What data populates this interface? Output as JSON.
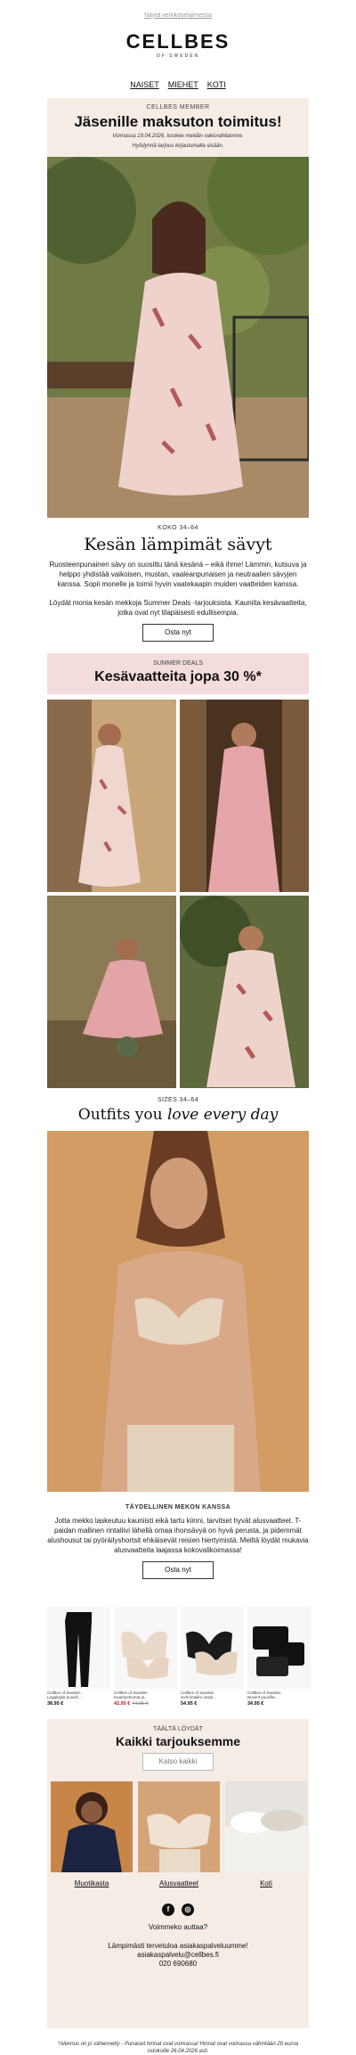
{
  "preheader": {
    "link": "Näytä verkkoselaimessa"
  },
  "logo": {
    "brand": "CELLBES",
    "sub": "OF SWEDEN"
  },
  "nav": [
    "NAISET",
    "MIEHET",
    "KOTI"
  ],
  "member": {
    "kicker": "CELLBES MEMBER",
    "title": "Jäsenille maksuton toimitus!",
    "note1": "Voimassa 19.04.2026, koskee meidän vakiorahtiamme.",
    "note2": "Hyödynnä tarjous kirjautumalla sisään."
  },
  "warm": {
    "kicker": "KOKO 34–64",
    "title": "Kesän lämpimät sävyt",
    "p1": "Ruosteenpunainen sävy on suosittu tänä kesänä – eikä ihme! Lämmin, kutsuva ja helppo yhdistää vaikoisen, mustan, vaaleanpunaisen ja neutraalien sävyjen kanssa. Sopii monelle ja toimii hyvin vaatekaapin muiden vaatteiden kanssa.",
    "p2": "Löydät monia kesän mekkoja Summer Deals -tarjouksista. Kauniita kesävaatteita, jotka ovat nyt tilapäisesti edullisempia.",
    "cta": "Osta nyt"
  },
  "deals": {
    "kicker": "SUMMER DEALS",
    "title": "Kesävaatteita jopa 30 %*"
  },
  "outfits": {
    "kicker": "SIZES 34–64",
    "title_plain": "Outfits you ",
    "title_italic": "love every day"
  },
  "perfect": {
    "kicker": "TÄYDELLINEN MEKON KANSSA",
    "text": "Jotta mekko laskeutuu kauniisti eikä tartu kiinni, tarvitset hyvät alusvaatteet. T-paidan mallinen rintaliivi lähellä omaa ihonsävyä on hyvä perusta, ja pidemmät alushousut tai pyöräilyshortsit ehkäisevät reisien hiertymistä. Meiltä löydät mukavia alusvaatteita laajassa kokovalikoimassa!",
    "cta": "Osta nyt"
  },
  "products": [
    {
      "brand": "Cellbes of Sweden",
      "name": "Leggingsit puuvill...",
      "price": "38.95 €",
      "old": ""
    },
    {
      "brand": "Cellbes of Sweden",
      "name": "Kaarituettomat ja...",
      "price": "42.95 €",
      "old": "44.95 €"
    },
    {
      "brand": "Cellbes of Sweden",
      "name": "Soft-rintaliivi vetyk...",
      "price": "54.95 €",
      "old": ""
    },
    {
      "brand": "Cellbes of Sweden",
      "name": "Boxerit puuvilla...",
      "price": "34.95 €",
      "old": ""
    }
  ],
  "offers": {
    "kicker": "TÄÄLTÄ LÖYDÄT",
    "title": "Kaikki tarjouksemme",
    "cta": "Katso kaikki"
  },
  "categories": [
    "Muotikasta",
    "Alusvaatteet",
    "Koti"
  ],
  "footer": {
    "help": "Voimmeko auttaa?",
    "line1": "Lämpimästi tervetuloa asiakaspalveluumme!",
    "line2": "asiakaspalvelu@cellbes.fi",
    "line3": "020 690680"
  },
  "legal": "*Alennus on jo vähennetty - Punaiset hinnat ovat voimassa! Hinnat ovat voimassa vähintään 20 euroa ostoksille 26.04.2026 asti.",
  "colors": {
    "member_bg": "#f6ece6",
    "deals_bg": "#f3dcdb",
    "sale": "#c0192c"
  }
}
